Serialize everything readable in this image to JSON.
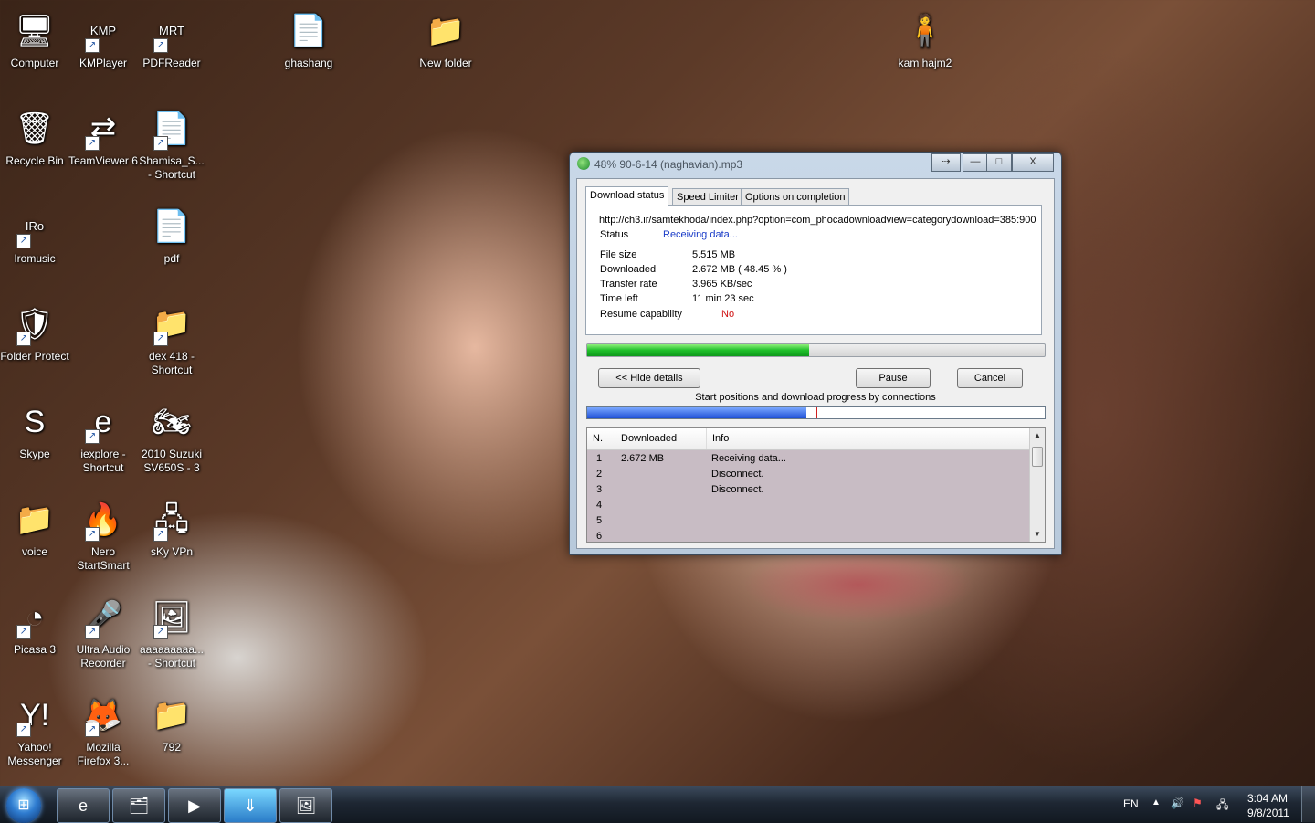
{
  "desktop": {
    "icons": [
      {
        "label": "Computer",
        "glyph": "🖥"
      },
      {
        "label": "KMPlayer",
        "glyph": "KMP"
      },
      {
        "label": "PDFReader",
        "glyph": "MRT"
      },
      {
        "label": "ghashang",
        "glyph": "📄"
      },
      {
        "label": "New folder",
        "glyph": "📁"
      },
      {
        "label": "kam hajm2",
        "glyph": "🧍"
      },
      {
        "label": "Recycle Bin",
        "glyph": "🗑"
      },
      {
        "label": "TeamViewer 6",
        "glyph": "⇄"
      },
      {
        "label": "Shamisa_S... - Shortcut",
        "glyph": "📄"
      },
      {
        "label": "Iromusic",
        "glyph": "IRo"
      },
      {
        "label": "pdf",
        "glyph": "📄"
      },
      {
        "label": "Folder Protect",
        "glyph": "🛡"
      },
      {
        "label": "dex 418 - Shortcut",
        "glyph": "📁"
      },
      {
        "label": "Skype",
        "glyph": "S"
      },
      {
        "label": "iexplore - Shortcut",
        "glyph": "e"
      },
      {
        "label": "2010 Suzuki SV650S - 3",
        "glyph": "🏍"
      },
      {
        "label": "voice",
        "glyph": "📁"
      },
      {
        "label": "Nero StartSmart",
        "glyph": "🔥"
      },
      {
        "label": "sKy VPn",
        "glyph": "🖧"
      },
      {
        "label": "Picasa 3",
        "glyph": "◔"
      },
      {
        "label": "Ultra Audio Recorder",
        "glyph": "🎤"
      },
      {
        "label": "aaaaaaaaa... - Shortcut",
        "glyph": "🖼"
      },
      {
        "label": "Yahoo! Messenger",
        "glyph": "Y!"
      },
      {
        "label": "Mozilla Firefox 3...",
        "glyph": "🦊"
      },
      {
        "label": "792",
        "glyph": "📁"
      }
    ]
  },
  "window": {
    "title": "48% 90-6-14 (naghavian).mp3",
    "title_buttons": {
      "pin": "⇢",
      "minimize": "—",
      "maximize": "□",
      "close": "X"
    },
    "tabs": [
      "Download status",
      "Speed Limiter",
      "Options on completion"
    ],
    "url": "http://ch3.ir/samtekhoda/index.php?option=com_phocadownloadview=categorydownload=385:900",
    "status_label": "Status",
    "status_value": "Receiving data...",
    "file_size_label": "File size",
    "file_size_value": "5.515  MB",
    "downloaded_label": "Downloaded",
    "downloaded_value": "2.672  MB  ( 48.45 % )",
    "transfer_rate_label": "Transfer rate",
    "transfer_rate_value": "3.965  KB/sec",
    "time_left_label": "Time left",
    "time_left_value": "11 min 23 sec",
    "resume_label": "Resume capability",
    "resume_value": "No",
    "progress_percent": 48.45,
    "hide_details": "<< Hide details",
    "pause": "Pause",
    "cancel": "Cancel",
    "connections_caption": "Start positions and download progress by connections",
    "connections_progress_fraction": 0.48,
    "connection_markers_fraction": [
      0.5,
      0.75
    ],
    "list_headers": [
      "N.",
      "Downloaded",
      "Info"
    ],
    "rows": [
      {
        "n": "1",
        "downloaded": "2.672  MB",
        "info": "Receiving data..."
      },
      {
        "n": "2",
        "downloaded": "",
        "info": "Disconnect."
      },
      {
        "n": "3",
        "downloaded": "",
        "info": "Disconnect."
      },
      {
        "n": "4",
        "downloaded": "",
        "info": ""
      },
      {
        "n": "5",
        "downloaded": "",
        "info": ""
      },
      {
        "n": "6",
        "downloaded": "",
        "info": ""
      }
    ],
    "colors": {
      "status_blue": "#1a3cc8",
      "resume_red": "#d01010",
      "progress_green": "#1fbf2a"
    }
  },
  "taskbar": {
    "start_glyph": "⊞",
    "items": [
      {
        "name": "internet-explorer",
        "glyph": "e",
        "active": false
      },
      {
        "name": "windows-explorer",
        "glyph": "🗂",
        "active": false
      },
      {
        "name": "media-player",
        "glyph": "▶",
        "active": false
      },
      {
        "name": "internet-download-manager",
        "glyph": "⇓",
        "active": true
      },
      {
        "name": "picture-viewer",
        "glyph": "🖼",
        "active": false
      }
    ],
    "language": "EN",
    "time": "3:04 AM",
    "date": "9/8/2011"
  }
}
